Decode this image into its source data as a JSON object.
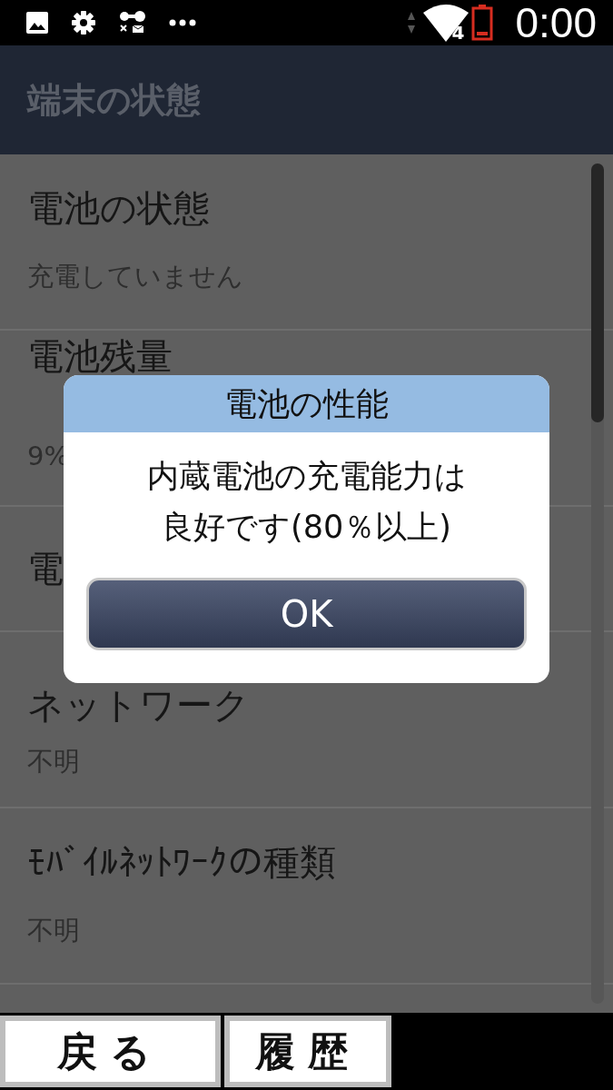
{
  "status_bar": {
    "network_badge": "4",
    "battery_low": true,
    "time": "0:00"
  },
  "app_bar": {
    "title": "端末の状態"
  },
  "items": [
    {
      "title": "電池の状態",
      "value": "充電していません"
    },
    {
      "title": "電池残量",
      "value": "9%"
    },
    {
      "title": "電"
    },
    {
      "title": "ネットワーク",
      "value": "不明"
    },
    {
      "title": "ﾓﾊﾞｲﾙﾈｯﾄﾜｰｸの種類",
      "value": "不明"
    }
  ],
  "dialog": {
    "title": "電池の性能",
    "message_lines": [
      "内蔵電池の充電能力は",
      "良好です(80％以上)"
    ],
    "button": "OK"
  },
  "bottom_buttons": [
    {
      "label": "戻る"
    },
    {
      "label": "履歴"
    }
  ]
}
